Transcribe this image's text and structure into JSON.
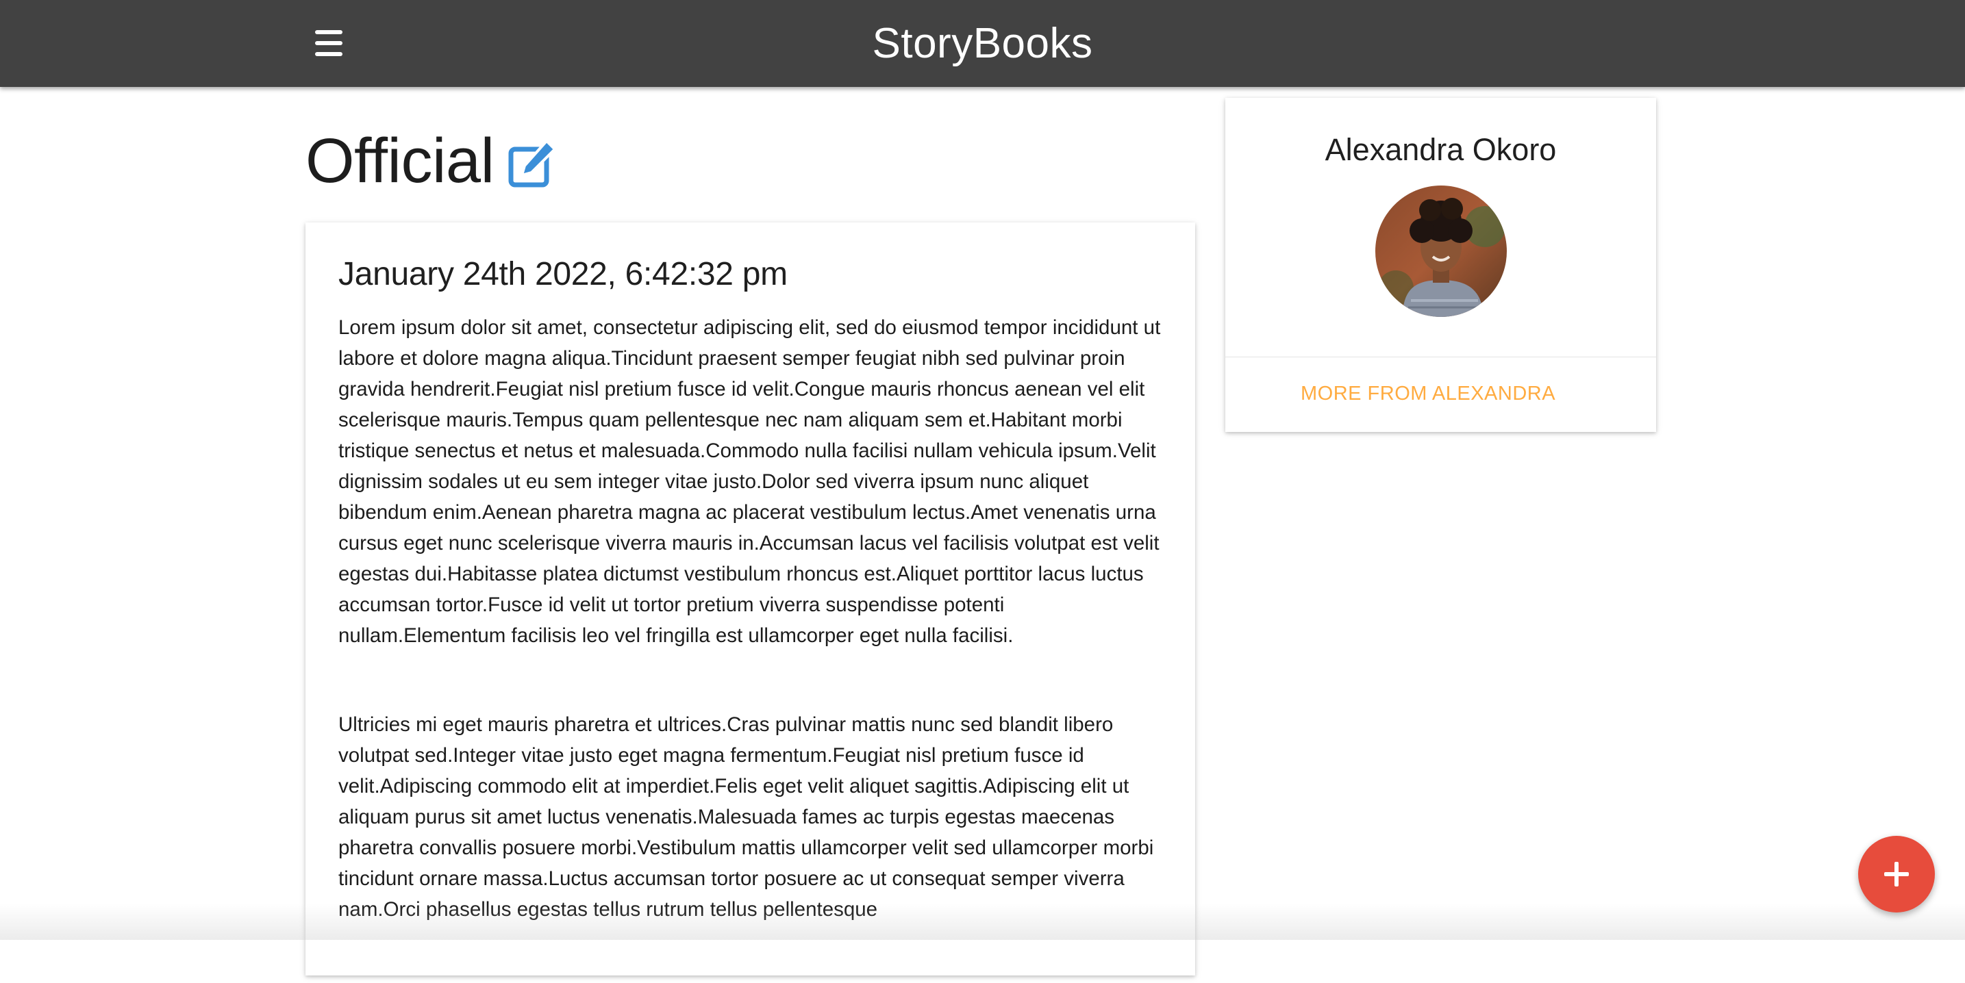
{
  "navbar": {
    "brand": "StoryBooks",
    "menu_icon": "hamburger-menu-icon",
    "background": "#424242"
  },
  "story": {
    "title": "Official",
    "edit_icon": "edit-pencil-icon",
    "date": "January 24th 2022, 6:42:32 pm",
    "paragraphs": [
      "Lorem ipsum dolor sit amet, consectetur adipiscing elit, sed do eiusmod tempor incididunt ut labore et dolore magna aliqua.Tincidunt praesent semper feugiat nibh sed pulvinar proin gravida hendrerit.Feugiat nisl pretium fusce id velit.Congue mauris rhoncus aenean vel elit scelerisque mauris.Tempus quam pellentesque nec nam aliquam sem et.Habitant morbi tristique senectus et netus et malesuada.Commodo nulla facilisi nullam vehicula ipsum.Velit dignissim sodales ut eu sem integer vitae justo.Dolor sed viverra ipsum nunc aliquet bibendum enim.Aenean pharetra magna ac placerat vestibulum lectus.Amet venenatis urna cursus eget nunc scelerisque viverra mauris in.Accumsan lacus vel facilisis volutpat est velit egestas dui.Habitasse platea dictumst vestibulum rhoncus est.Aliquet porttitor lacus luctus accumsan tortor.Fusce id velit ut tortor pretium viverra suspendisse potenti nullam.Elementum facilisis leo vel fringilla est ullamcorper eget nulla facilisi.",
      "Ultricies mi eget mauris pharetra et ultrices.Cras pulvinar mattis nunc sed blandit libero volutpat sed.Integer vitae justo eget magna fermentum.Feugiat nisl pretium fusce id velit.Adipiscing commodo elit at imperdiet.Felis eget velit aliquet sagittis.Adipiscing elit ut aliquam purus sit amet luctus venenatis.Malesuada fames ac turpis egestas maecenas pharetra convallis posuere morbi.Vestibulum mattis ullamcorper velit sed ullamcorper morbi tincidunt ornare massa.Luctus accumsan tortor posuere ac ut consequat semper viverra nam.Orci phasellus egestas tellus rutrum tellus pellentesque"
    ]
  },
  "author": {
    "name": "Alexandra Okoro",
    "more_link": "MORE FROM ALEXANDRA",
    "link_color": "#ffab40"
  },
  "fab": {
    "icon": "plus-icon",
    "color": "#e74c3c"
  }
}
